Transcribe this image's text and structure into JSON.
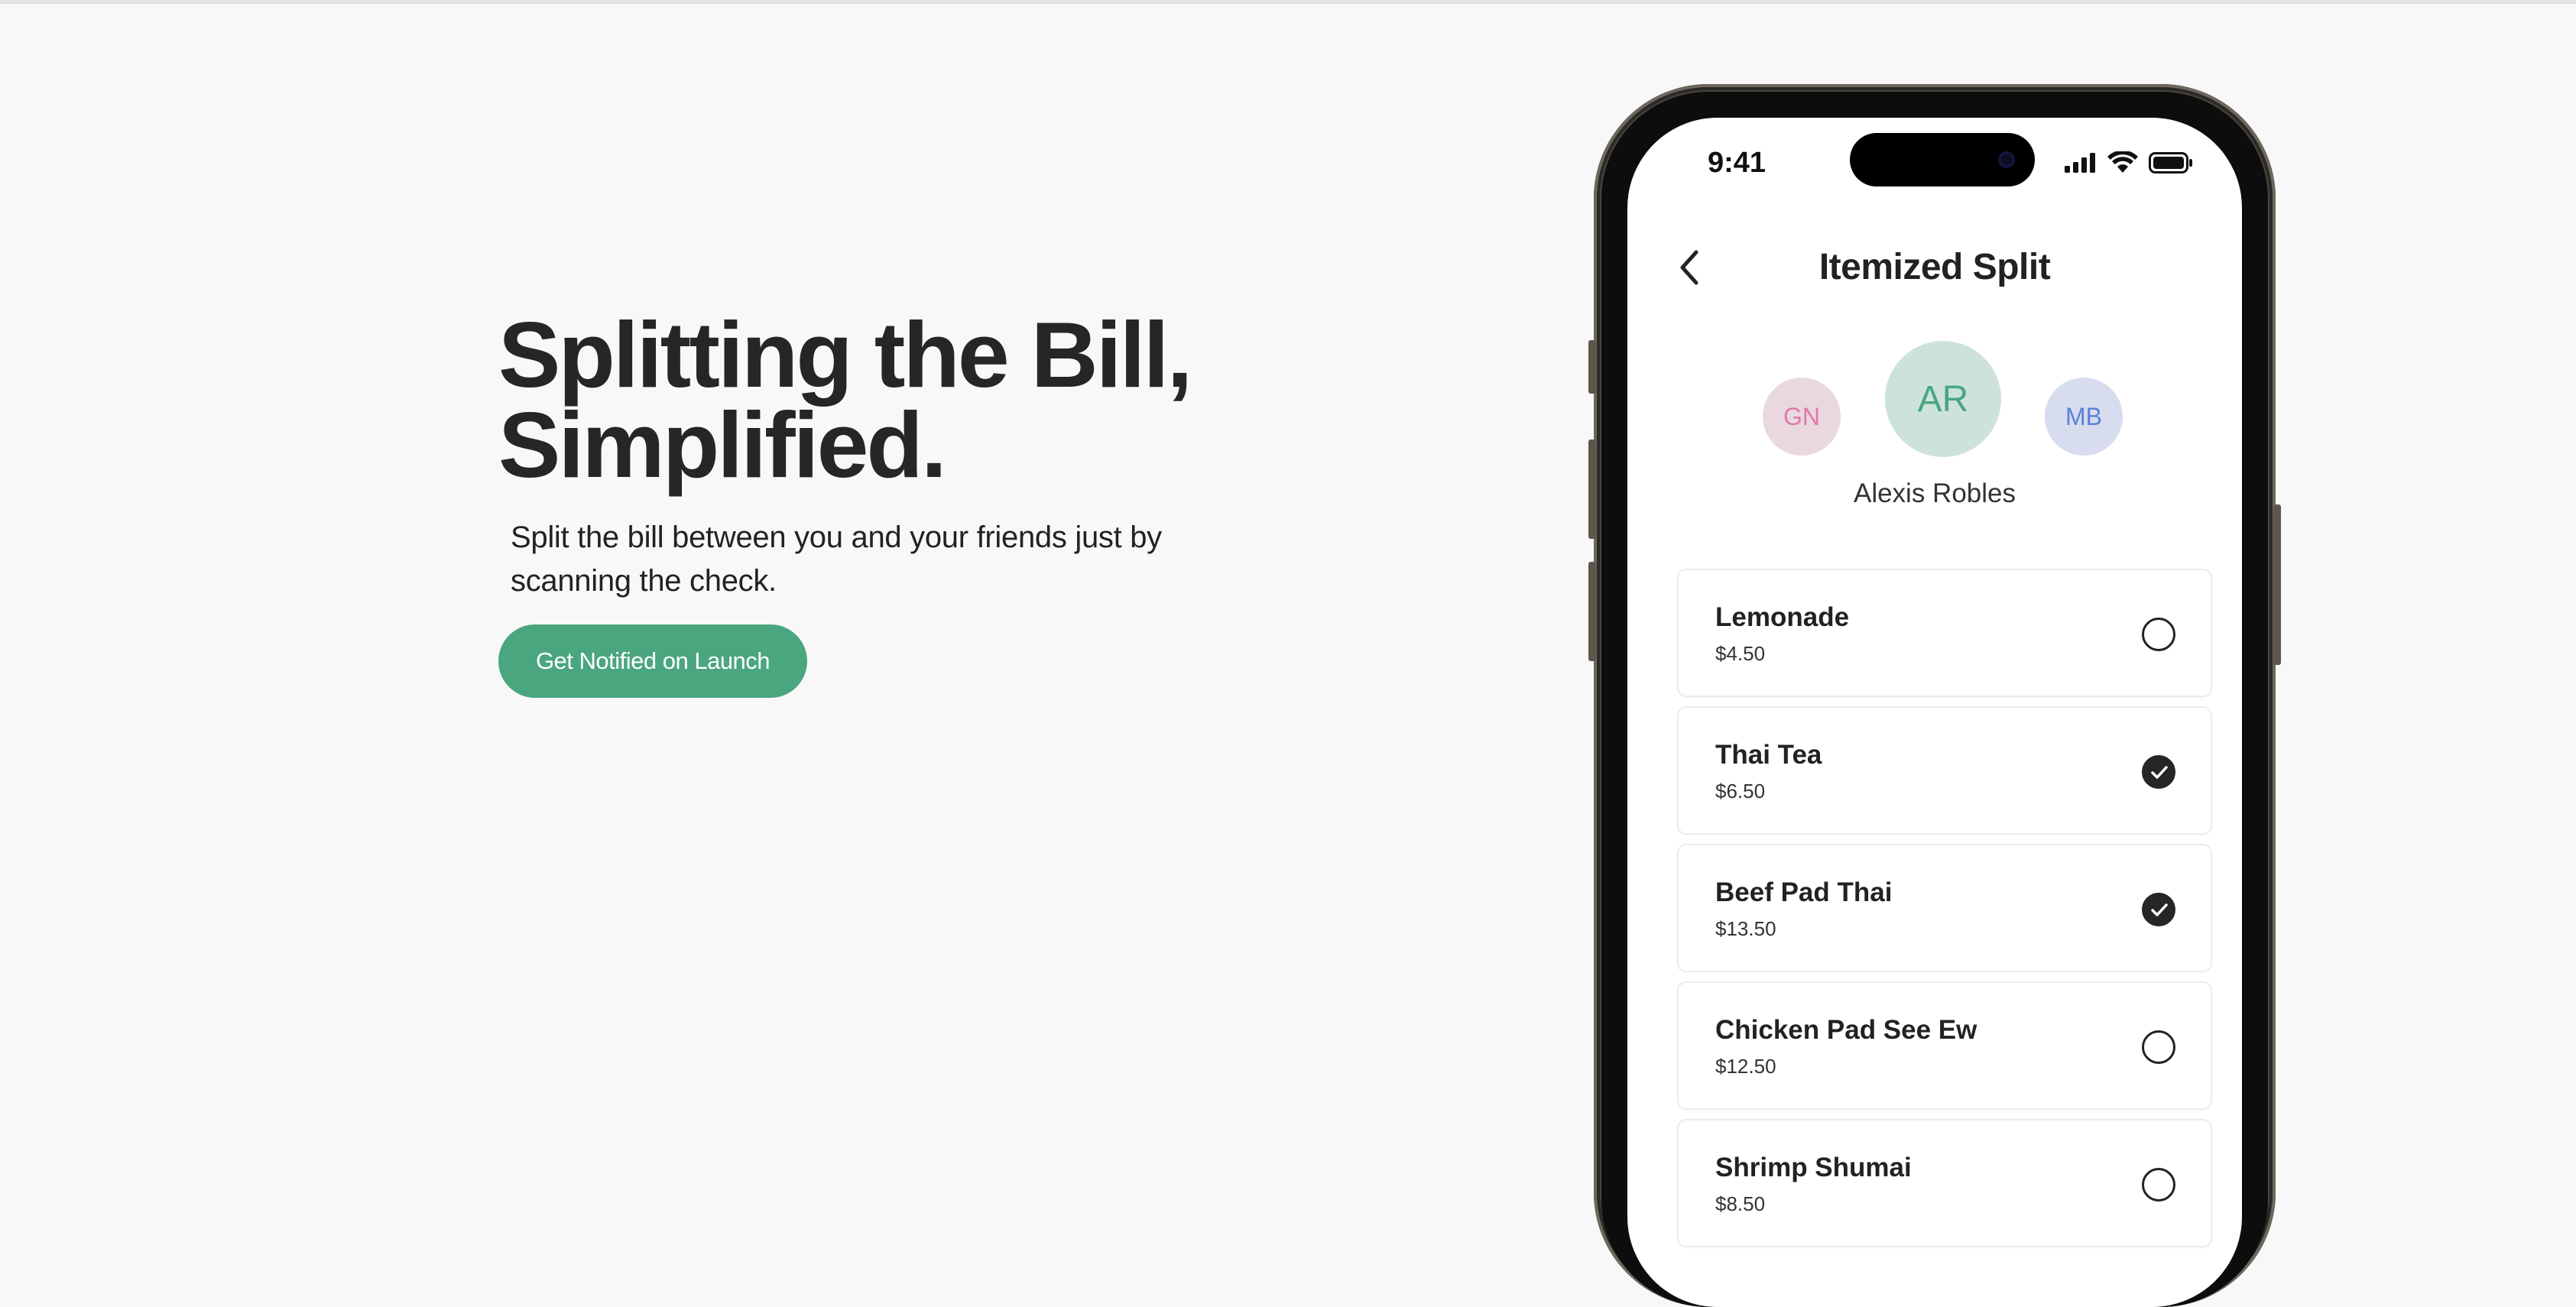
{
  "hero": {
    "title_line1": "Splitting the Bill,",
    "title_line2": "Simplified.",
    "subtitle_line1": "Split the bill between you and your friends just by",
    "subtitle_line2": "scanning the check.",
    "cta_label": "Get Notified on Launch"
  },
  "colors": {
    "accent": "#4aa67f",
    "dark": "#262626"
  },
  "phone": {
    "status": {
      "time": "9:41",
      "icons": [
        "signal-icon",
        "wifi-icon",
        "battery-icon"
      ]
    },
    "nav": {
      "title": "Itemized Split",
      "back_icon": "chevron-left-icon"
    },
    "avatars": [
      {
        "initials": "GN",
        "selected": false
      },
      {
        "initials": "AR",
        "selected": true
      },
      {
        "initials": "MB",
        "selected": false
      }
    ],
    "selected_name": "Alexis Robles",
    "items": [
      {
        "name": "Lemonade",
        "price": "$4.50",
        "checked": false
      },
      {
        "name": "Thai Tea",
        "price": "$6.50",
        "checked": true
      },
      {
        "name": "Beef Pad Thai",
        "price": "$13.50",
        "checked": true
      },
      {
        "name": "Chicken Pad See Ew",
        "price": "$12.50",
        "checked": false
      },
      {
        "name": "Shrimp Shumai",
        "price": "$8.50",
        "checked": false
      }
    ]
  }
}
